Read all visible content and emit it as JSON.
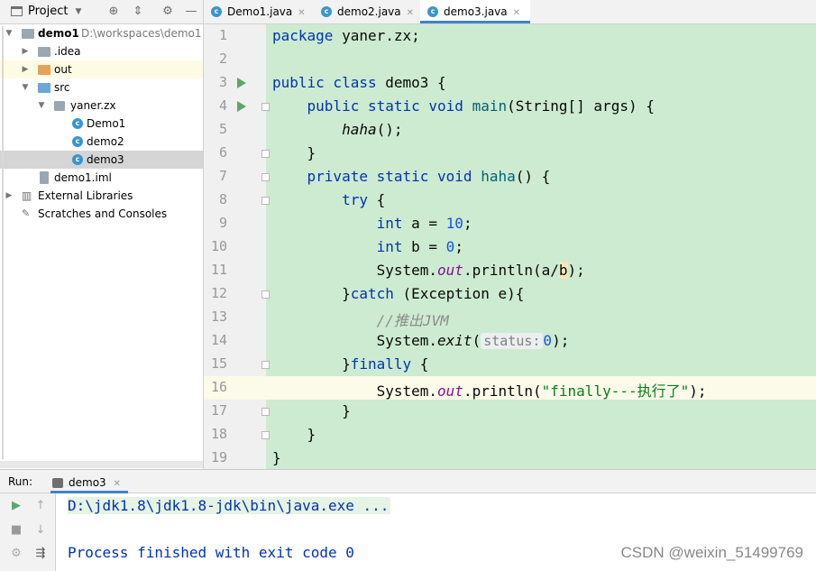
{
  "project_panel": {
    "title": "Project",
    "tree": [
      {
        "label": "demo1",
        "path": "D:\\workspaces\\demo1",
        "icon": "module-folder-icon"
      },
      {
        "label": ".idea",
        "icon": "folder-icon"
      },
      {
        "label": "out",
        "icon": "folder-orange-icon"
      },
      {
        "label": "src",
        "icon": "source-folder-icon"
      },
      {
        "label": "yaner.zx",
        "icon": "package-icon"
      },
      {
        "label": "Demo1",
        "icon": "java-class-icon"
      },
      {
        "label": "demo2",
        "icon": "java-class-icon"
      },
      {
        "label": "demo3",
        "icon": "java-class-icon"
      },
      {
        "label": "demo1.iml",
        "icon": "iml-file-icon"
      },
      {
        "label": "External Libraries",
        "icon": "library-icon"
      },
      {
        "label": "Scratches and Consoles",
        "icon": "scratches-icon"
      }
    ]
  },
  "editor": {
    "tabs": [
      {
        "label": "Demo1.java"
      },
      {
        "label": "demo2.java"
      },
      {
        "label": "demo3.java",
        "active": true
      }
    ],
    "line_numbers": [
      "1",
      "2",
      "3",
      "4",
      "5",
      "6",
      "7",
      "8",
      "9",
      "10",
      "11",
      "12",
      "13",
      "14",
      "15",
      "16",
      "17",
      "18",
      "19"
    ],
    "code": {
      "l1_kw": "package",
      "l1_rest": " yaner.zx;",
      "l3_kw": "public class",
      "l3_rest": " demo3 {",
      "l4_kw": "public static void",
      "l4_fn": "main",
      "l4_rest": "(String[] args) {",
      "l5_call": "haha",
      "l5_rest": "();",
      "l6": "}",
      "l7_kw": "private static void",
      "l7_fn": "haha",
      "l7_rest": "() {",
      "l8_kw": "try",
      "l8_rest": " {",
      "l9_kw": "int",
      "l9_mid": " a = ",
      "l9_num": "10",
      "l9_end": ";",
      "l10_kw": "int",
      "l10_mid": " b = ",
      "l10_num": "0",
      "l10_end": ";",
      "l11_a": "System.",
      "l11_fld": "out",
      "l11_b": ".println(a/",
      "l11_caret": "b",
      "l11_c": ");",
      "l12_a": "}",
      "l12_kw": "catch",
      "l12_rest": " (Exception e){",
      "l13_cmt": "//推出JVM",
      "l14_a": "System.",
      "l14_call": "exit",
      "l14_b": "(",
      "l14_hint": "status:",
      "l14_num": "0",
      "l14_c": ");",
      "l15_a": "}",
      "l15_kw": "finally",
      "l15_rest": " {",
      "l16_a": "System.",
      "l16_fld": "out",
      "l16_b": ".println(",
      "l16_str": "\"finally---执行了\"",
      "l16_c": ");",
      "l17": "}",
      "l18": "}",
      "l19": "}"
    }
  },
  "run_panel": {
    "label": "Run:",
    "tab": "demo3",
    "console": [
      "D:\\jdk1.8\\jdk1.8-jdk\\bin\\java.exe ...",
      "Process finished with exit code 0"
    ]
  },
  "watermark": "CSDN @weixin_51499769",
  "colors": {
    "code_background": "#cdebd0",
    "keyword": "#0033b3",
    "string": "#067d17",
    "number": "#1750eb",
    "tab_underline": "#4083c9"
  }
}
